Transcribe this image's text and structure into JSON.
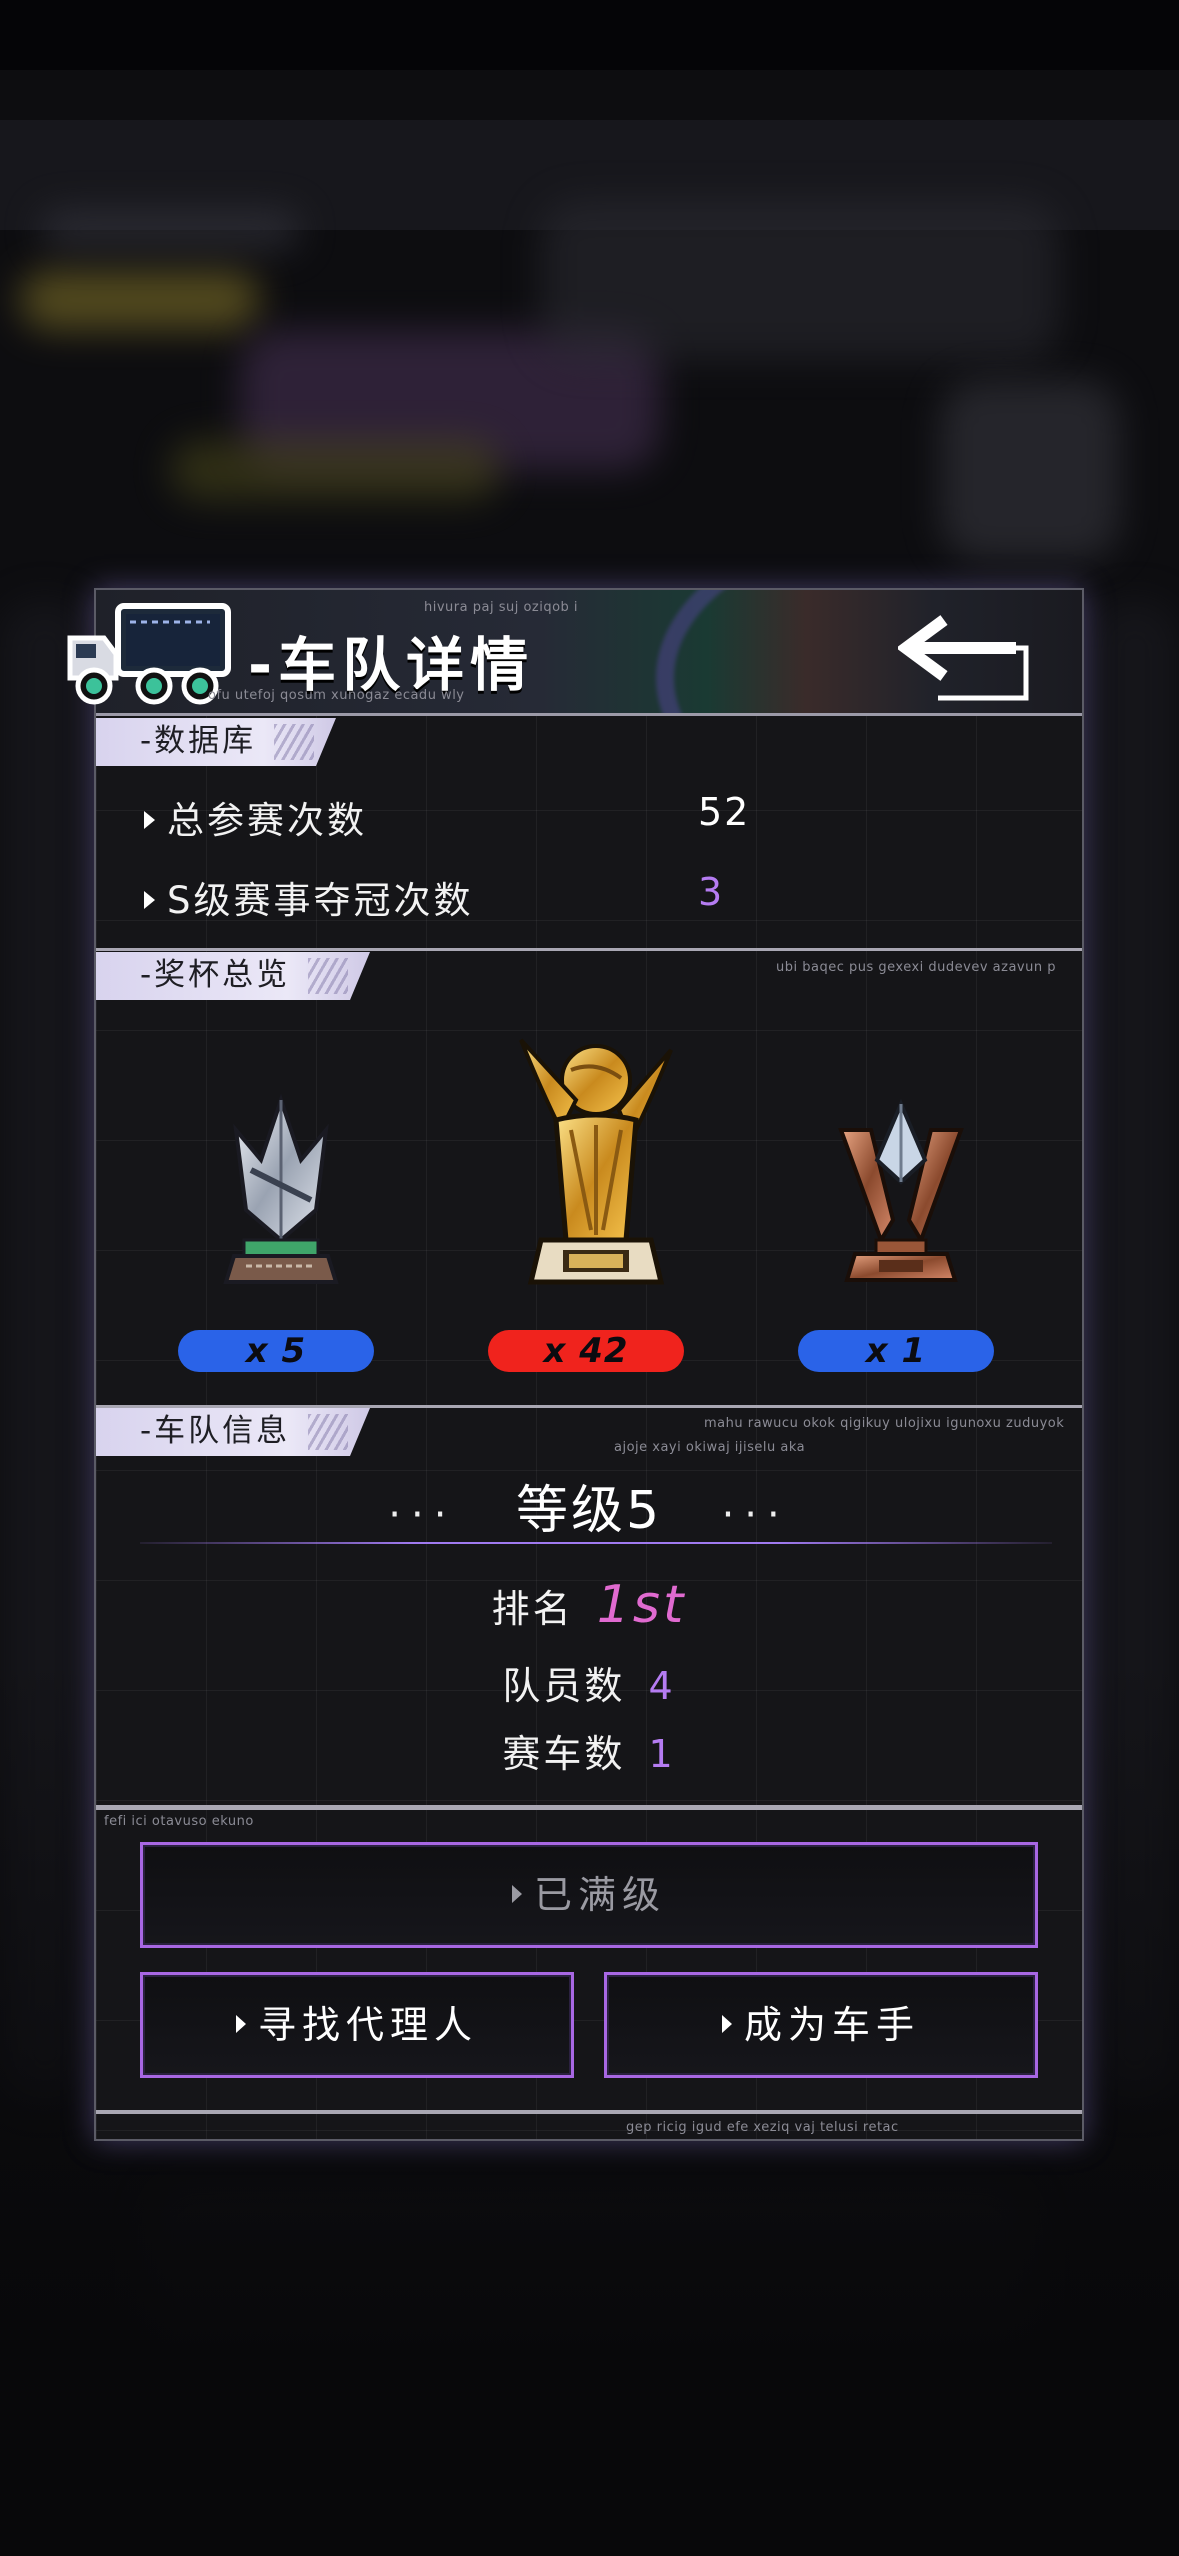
{
  "panel": {
    "title": "-车队详情",
    "header_small_text_1": "hivura paj suj oziqob i",
    "header_small_text_2": "ofu utefoj qosum xunogaz ecadu wly"
  },
  "database": {
    "tag": "-数据库",
    "rows": [
      {
        "label": "总参赛次数",
        "value": "52",
        "value_color": "#ffffff"
      },
      {
        "label": "S级赛事夺冠次数",
        "value": "3",
        "value_color": "#b57cf2"
      }
    ]
  },
  "trophies": {
    "tag": "-奖杯总览",
    "small_text": "ubi baqec pus gexexi dudevev azavun p",
    "items": [
      {
        "name": "silver-trophy",
        "count": "x 5",
        "pill_color": "#2a63e8"
      },
      {
        "name": "gold-trophy",
        "count": "x 42",
        "pill_color": "#f0231d"
      },
      {
        "name": "bronze-trophy",
        "count": "x 1",
        "pill_color": "#2a63e8"
      }
    ]
  },
  "team_info": {
    "tag": "-车队信息",
    "small_text_1": "mahu rawucu okok qigikuy ulojixu igunoxu zuduyok",
    "small_text_2": "ajoje xayi okiwaj ijiselu aka",
    "dots_left": "···",
    "level": "等级5",
    "dots_right": "···",
    "rank_label": "排名",
    "rank_value": "1st",
    "members_label": "队员数",
    "members_value": "4",
    "cars_label": "赛车数",
    "cars_value": "1"
  },
  "actions": {
    "small_text": "fefi ici otavuso ekuno",
    "max_level_label": "已满级",
    "find_agent_label": "寻找代理人",
    "become_driver_label": "成为车手",
    "footer_small_text": "gep ricig igud efe xeziq vaj telusi retac"
  },
  "colors": {
    "accent_purple": "#a867e3",
    "value_purple": "#b57cf2",
    "rank_pink": "#e06ad0"
  }
}
